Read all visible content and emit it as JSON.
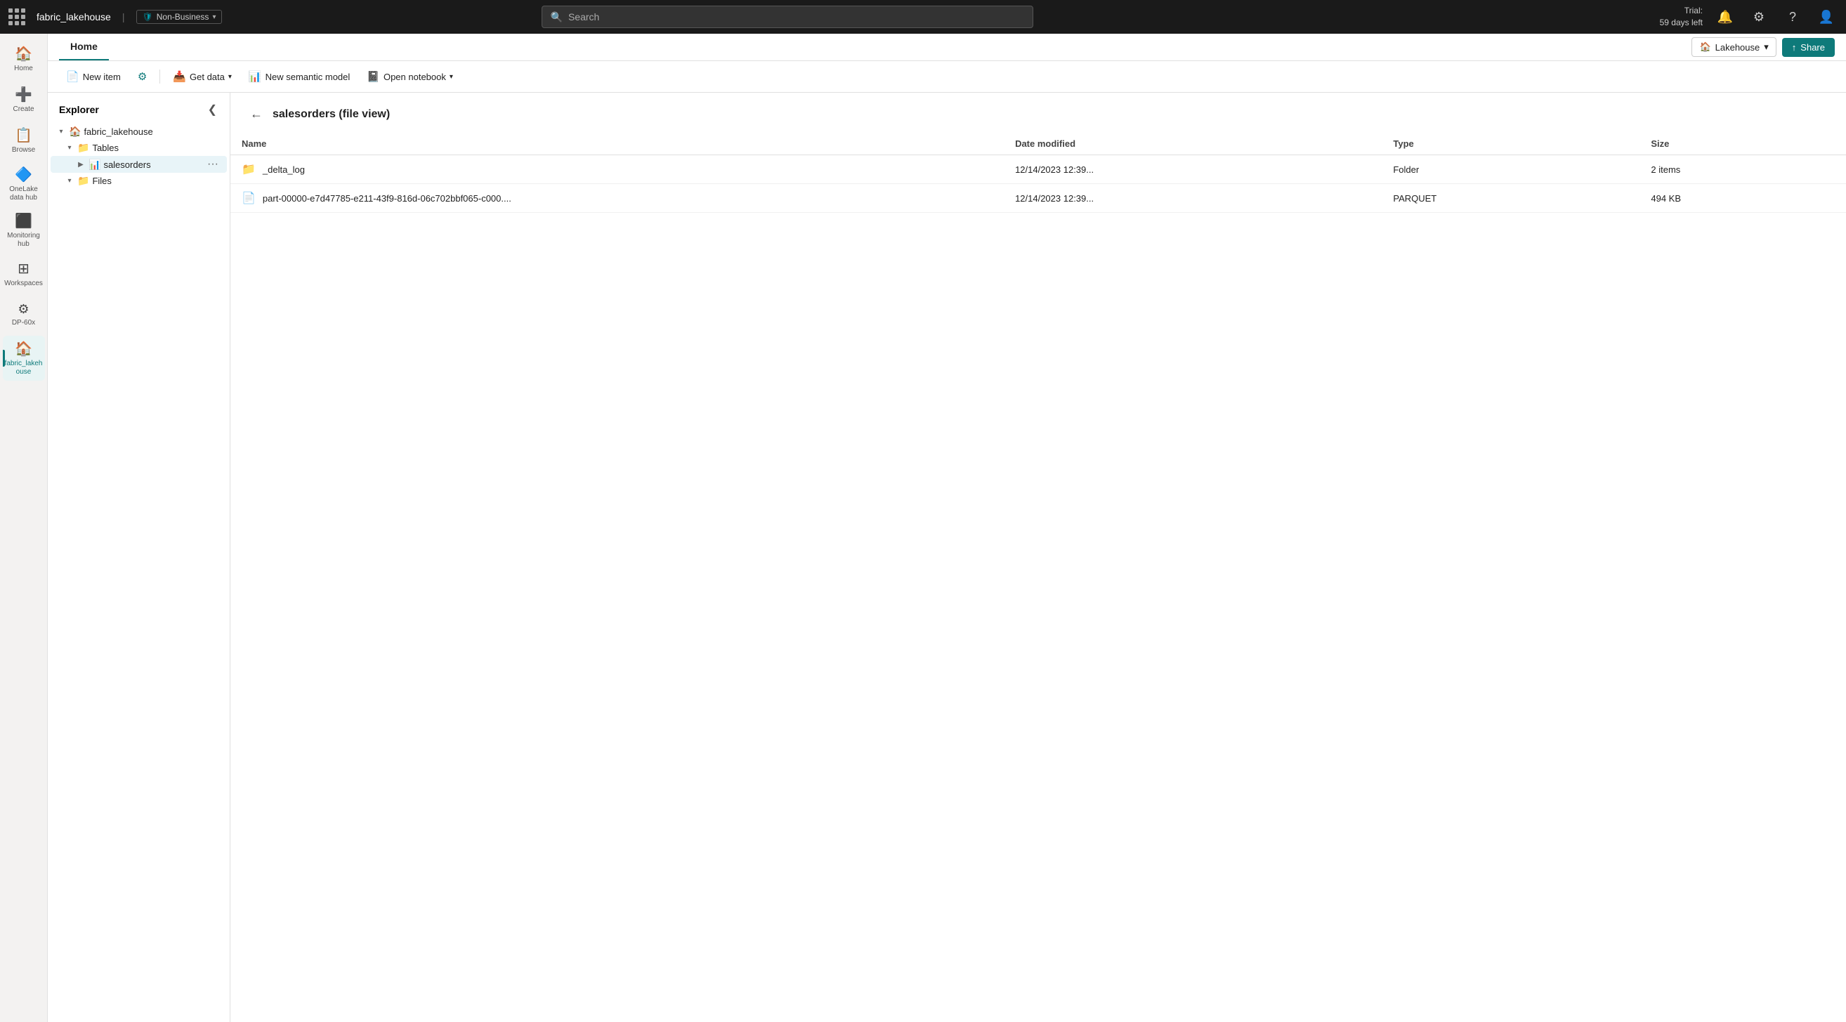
{
  "app": {
    "name": "fabric_lakehouse",
    "badge": "Non-Business",
    "shield": "🛡"
  },
  "topbar": {
    "search_placeholder": "Search",
    "trial_line1": "Trial:",
    "trial_line2": "59 days left"
  },
  "toolbar_tab": {
    "home_label": "Home",
    "lakehouse_label": "Lakehouse",
    "share_label": "Share"
  },
  "toolbar": {
    "new_item_label": "New item",
    "settings_label": "Settings",
    "get_data_label": "Get data",
    "new_semantic_label": "New semantic model",
    "open_notebook_label": "Open notebook"
  },
  "explorer": {
    "title": "Explorer",
    "root": "fabric_lakehouse",
    "sections": [
      {
        "name": "Tables",
        "children": [
          {
            "name": "salesorders",
            "selected": true
          }
        ]
      },
      {
        "name": "Files",
        "children": []
      }
    ]
  },
  "file_view": {
    "title": "salesorders (file view)",
    "columns": [
      "Name",
      "Date modified",
      "Type",
      "Size"
    ],
    "rows": [
      {
        "icon": "folder",
        "name": "_delta_log",
        "date_modified": "12/14/2023 12:39...",
        "type": "Folder",
        "size": "2 items"
      },
      {
        "icon": "file",
        "name": "part-00000-e7d47785-e211-43f9-816d-06c702bbf065-c000....",
        "date_modified": "12/14/2023 12:39...",
        "type": "PARQUET",
        "size": "494 KB"
      }
    ]
  },
  "sidebar": {
    "items": [
      {
        "id": "home",
        "label": "Home",
        "icon": "🏠"
      },
      {
        "id": "create",
        "label": "Create",
        "icon": "➕"
      },
      {
        "id": "browse",
        "label": "Browse",
        "icon": "📋"
      },
      {
        "id": "onelake",
        "label": "OneLake data hub",
        "icon": "🔷"
      },
      {
        "id": "monitoring",
        "label": "Monitoring hub",
        "icon": "⬛"
      },
      {
        "id": "workspaces",
        "label": "Workspaces",
        "icon": "⊞"
      },
      {
        "id": "dp60x",
        "label": "DP-60x",
        "icon": "⚙"
      },
      {
        "id": "fabric_lakehouse",
        "label": "fabric_lakeh ouse",
        "icon": "🏠",
        "active": true
      }
    ]
  }
}
